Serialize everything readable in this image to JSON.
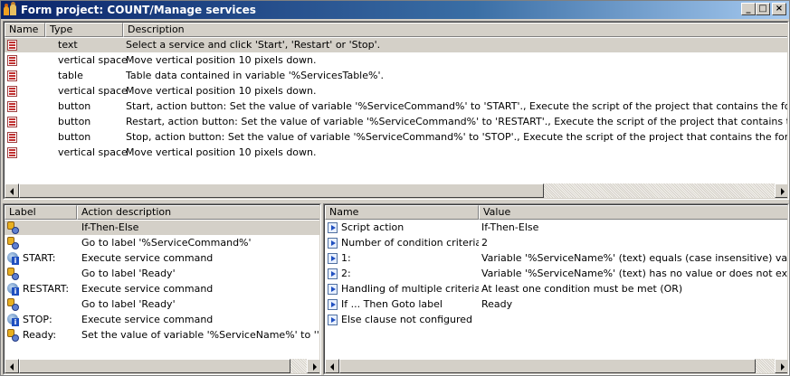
{
  "window": {
    "title": "Form project: COUNT/Manage services",
    "buttons": {
      "minimize": "_",
      "maximize": "□",
      "close": "×"
    }
  },
  "top_table": {
    "headers": [
      "Name",
      "Type",
      "Description"
    ],
    "rows": [
      {
        "type": "text",
        "description": "Select a service and click 'Start', 'Restart' or 'Stop'."
      },
      {
        "type": "vertical space",
        "description": "Move vertical position 10 pixels down."
      },
      {
        "type": "table",
        "description": "Table data contained in variable '%ServicesTable%'."
      },
      {
        "type": "vertical space",
        "description": "Move vertical position 10 pixels down."
      },
      {
        "type": "button",
        "description": "Start, action button: Set the value of variable '%ServiceCommand%' to 'START'., Execute the script of the project that contains the form., Re"
      },
      {
        "type": "button",
        "description": "Restart, action button: Set the value of variable '%ServiceCommand%' to 'RESTART'., Execute the script of the project that contains the form"
      },
      {
        "type": "button",
        "description": "Stop, action button: Set the value of variable '%ServiceCommand%' to 'STOP'., Execute the script of the project that contains the form., Ret"
      },
      {
        "type": "vertical space",
        "description": "Move vertical position 10 pixels down."
      }
    ]
  },
  "script_table": {
    "headers": [
      "Label",
      "Action description"
    ],
    "rows": [
      {
        "icon": "action-icon",
        "label": "",
        "action": "If-Then-Else"
      },
      {
        "icon": "action-icon",
        "label": "",
        "action": "Go to label '%ServiceCommand%'"
      },
      {
        "icon": "label-icon",
        "label": "START:",
        "action": "Execute service command"
      },
      {
        "icon": "action-icon",
        "label": "",
        "action": "Go to label 'Ready'"
      },
      {
        "icon": "label-icon",
        "label": "RESTART:",
        "action": "Execute service command"
      },
      {
        "icon": "action-icon",
        "label": "",
        "action": "Go to label 'Ready'"
      },
      {
        "icon": "label-icon",
        "label": "STOP:",
        "action": "Execute service command"
      },
      {
        "icon": "action-icon",
        "label": "Ready:",
        "action": "Set the value of variable '%ServiceName%' to ''."
      }
    ]
  },
  "properties_table": {
    "headers": [
      "Name",
      "Value"
    ],
    "rows": [
      {
        "name": "Script action",
        "value": "If-Then-Else"
      },
      {
        "name": "Number of condition criteria",
        "value": "2"
      },
      {
        "name": "1:",
        "value": "Variable '%ServiceName%' (text) equals (case insensitive) value ''"
      },
      {
        "name": "2:",
        "value": "Variable '%ServiceName%' (text) has no value or does not exist"
      },
      {
        "name": "Handling of multiple criteria",
        "value": "At least one condition must be met (OR)"
      },
      {
        "name": "If ... Then Goto label",
        "value": "Ready"
      },
      {
        "name": "Else clause not configured",
        "value": ""
      }
    ]
  }
}
